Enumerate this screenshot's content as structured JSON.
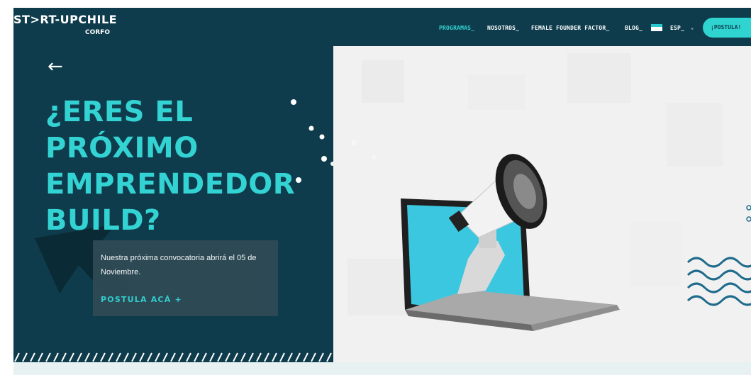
{
  "brand": {
    "logo_text": "ST>RT-UPCHILE",
    "logo_sub": "CORFO"
  },
  "nav": {
    "items": [
      "PROGRAMAS_",
      "NOSOTROS_",
      "FEMALE FOUNDER FACTOR_",
      "BLOG_"
    ],
    "active_index": 0,
    "language": "ESP_",
    "cta": "¡POSTULA!"
  },
  "hero": {
    "back_icon": "←",
    "title_lines": [
      "¿ERES EL",
      "PRÓXIMO",
      "EMPRENDEDOR",
      "BUILD?"
    ],
    "description": "Nuestra próxima convocatoria abrirá el 05 de Noviembre.",
    "link": "POSTULA ACÁ  +"
  },
  "colors": {
    "background": "#0e3c4c",
    "accent": "#34d3d3",
    "card": "#2e4a55",
    "panel": "#f2f2f2",
    "wave": "#1e6b8c"
  },
  "icons": [
    "arrow-left-icon",
    "chevron-down-icon",
    "flag-icon",
    "plus-icon",
    "cursor-arrow-icon",
    "wave-icon"
  ]
}
